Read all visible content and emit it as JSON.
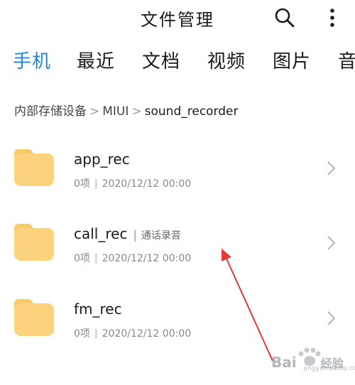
{
  "header": {
    "title": "文件管理",
    "search_icon": "search-icon",
    "more_icon": "more-vertical-icon"
  },
  "tabs": [
    {
      "label": "手机",
      "active": true
    },
    {
      "label": "最近"
    },
    {
      "label": "文档"
    },
    {
      "label": "视频"
    },
    {
      "label": "图片"
    },
    {
      "label": "音"
    }
  ],
  "breadcrumb": {
    "segments": [
      "内部存储设备",
      "MIUI",
      "sound_recorder"
    ],
    "separator": ">"
  },
  "files": [
    {
      "name": "app_rec",
      "tag": "",
      "count": "0项",
      "date": "2020/12/12 00:00"
    },
    {
      "name": "call_rec",
      "tag": "通话录音",
      "count": "0项",
      "date": "2020/12/12 00:00"
    },
    {
      "name": "fm_rec",
      "tag": "",
      "count": "0项",
      "date": "2020/12/12 00:00"
    }
  ],
  "meta_separator": "|",
  "watermark": {
    "text": "Bai",
    "suffix": "经验",
    "sub": "jingyan.baidu.com"
  },
  "colors": {
    "accent": "#1e88d8",
    "folder": "#fcd27c",
    "annotation": "#e53935"
  }
}
